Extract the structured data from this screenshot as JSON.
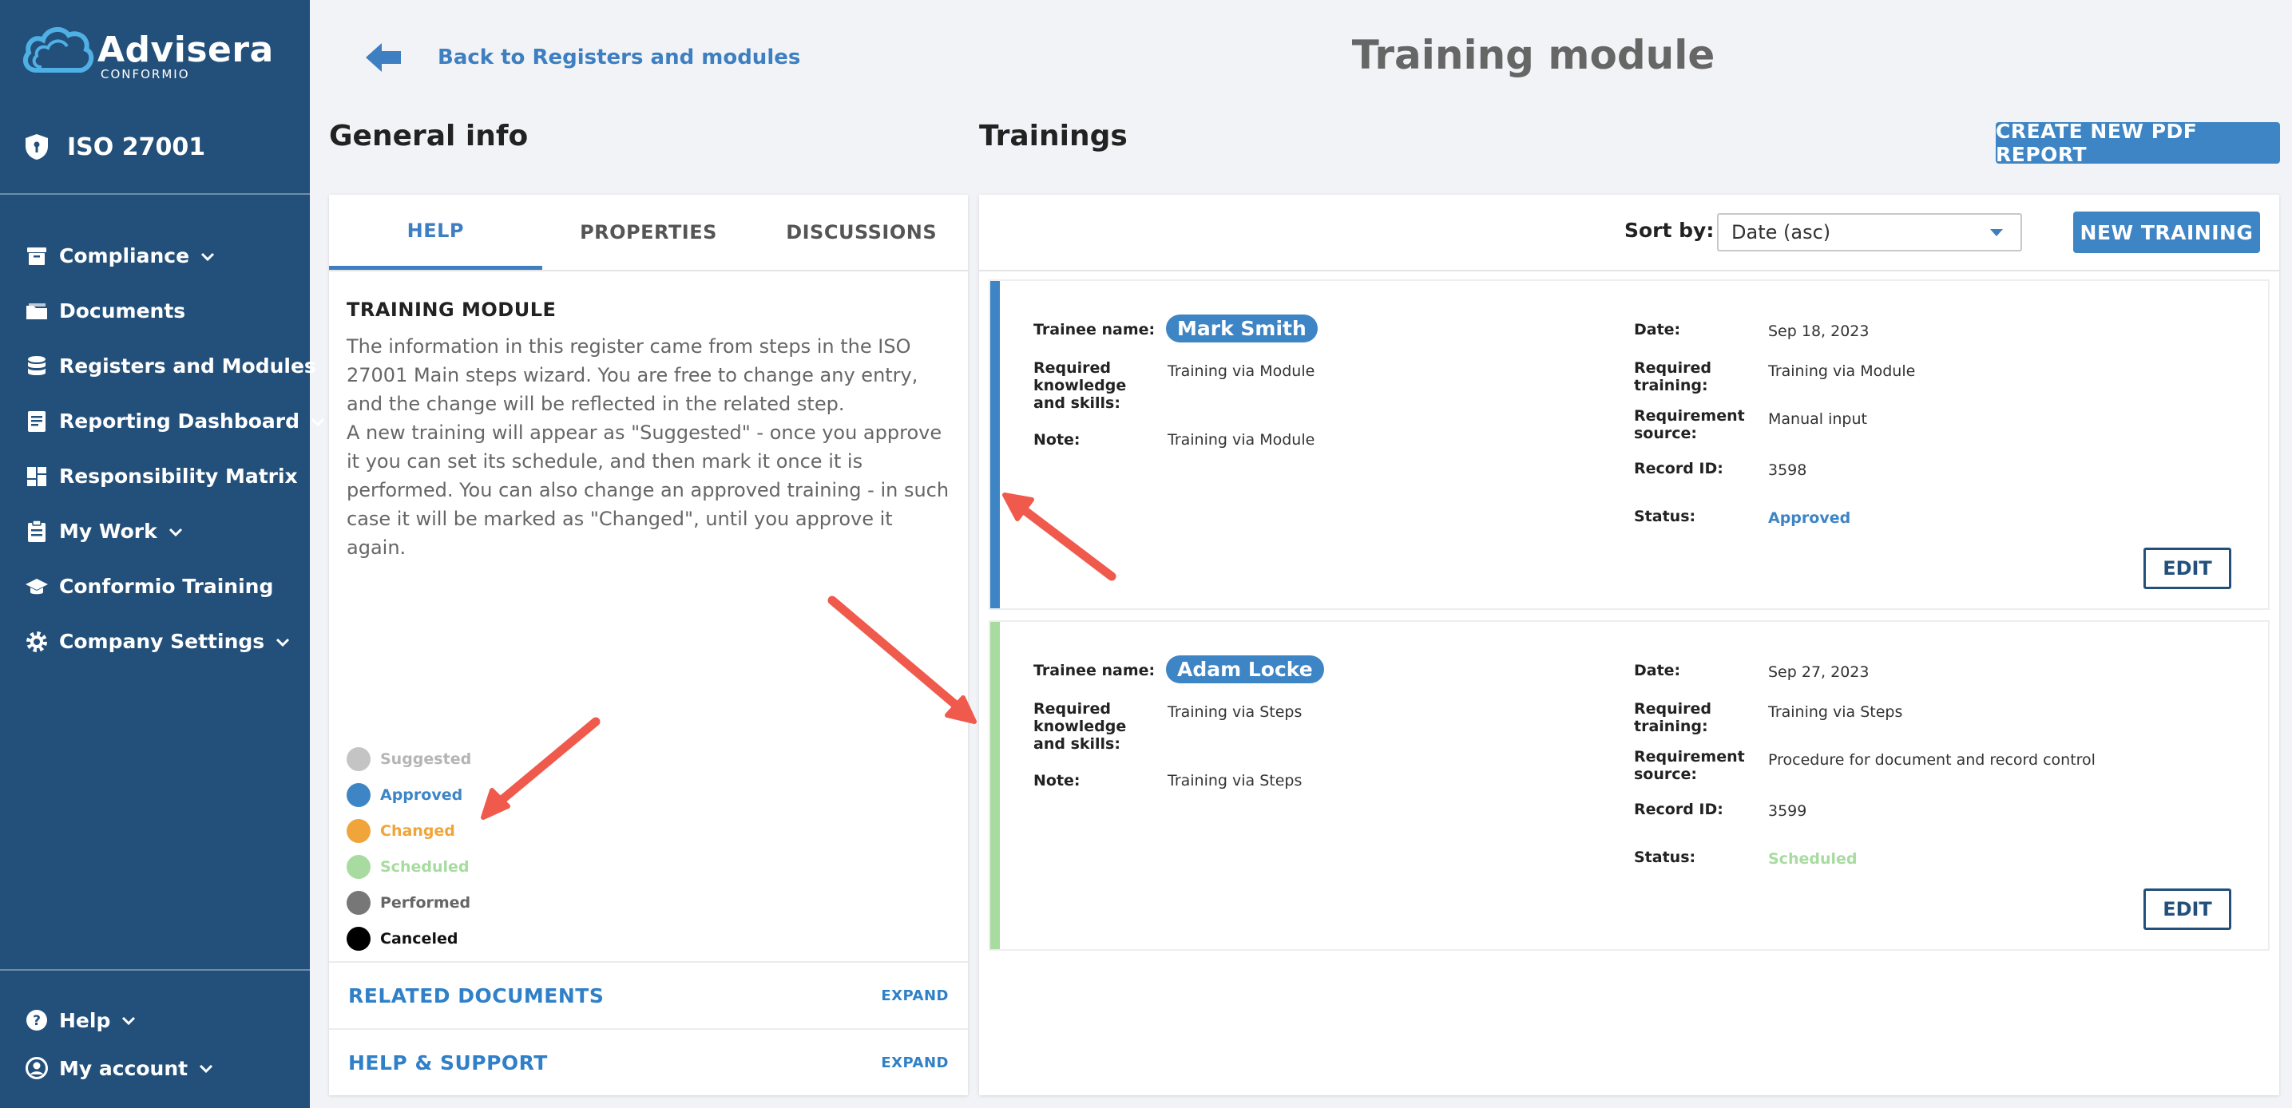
{
  "sidebar": {
    "logo_text": "Advisera",
    "logo_sub": "CONFORMIO",
    "standard": "ISO 27001",
    "items": [
      {
        "label": "Compliance",
        "icon": "archive-icon",
        "chevron": true
      },
      {
        "label": "Documents",
        "icon": "folder-icon",
        "chevron": false
      },
      {
        "label": "Registers and Modules",
        "icon": "database-icon",
        "chevron": false
      },
      {
        "label": "Reporting Dashboard",
        "icon": "report-icon",
        "chevron": true
      },
      {
        "label": "Responsibility Matrix",
        "icon": "dashboard-icon",
        "chevron": false
      },
      {
        "label": "My Work",
        "icon": "clipboard-icon",
        "chevron": true
      },
      {
        "label": "Conformio Training",
        "icon": "graduation-cap-icon",
        "chevron": false
      },
      {
        "label": "Company Settings",
        "icon": "gear-icon",
        "chevron": true
      }
    ],
    "bottom": [
      {
        "label": "Help",
        "icon": "help-circle-icon"
      },
      {
        "label": "My account",
        "icon": "account-icon"
      }
    ]
  },
  "header": {
    "back_label": "Back to Registers and modules",
    "title": "Training module"
  },
  "general": {
    "title": "General info",
    "tabs": [
      "HELP",
      "PROPERTIES",
      "DISCUSSIONS"
    ],
    "active_tab": "HELP",
    "help_title": "TRAINING MODULE",
    "help_text": "The information in this register came from steps in the ISO 27001 Main steps wizard. You are free to change any entry, and the change will be reflected in the related step.\nA new training will appear as \"Suggested\" - once you approve it you can set its schedule, and then mark it once it is performed. You can also change an approved training - in such case it will be marked as \"Changed\", until you approve it again.",
    "legend": [
      {
        "label": "Suggested",
        "color": "#c4c4c4",
        "text_color": "#b5b5b5"
      },
      {
        "label": "Approved",
        "color": "#3e85c6",
        "text_color": "#3e85c6"
      },
      {
        "label": "Changed",
        "color": "#f0a53a",
        "text_color": "#f0a53a"
      },
      {
        "label": "Scheduled",
        "color": "#a8dba0",
        "text_color": "#a8dba0"
      },
      {
        "label": "Performed",
        "color": "#777777",
        "text_color": "#666666"
      },
      {
        "label": "Canceled",
        "color": "#000000",
        "text_color": "#111111"
      }
    ],
    "accordions": [
      {
        "title": "RELATED DOCUMENTS",
        "action": "EXPAND"
      },
      {
        "title": "HELP & SUPPORT",
        "action": "EXPAND"
      }
    ]
  },
  "trainings": {
    "title": "Trainings",
    "create_pdf_label": "CREATE NEW PDF REPORT",
    "sort_label": "Sort by:",
    "sort_value": "Date (asc)",
    "new_training_label": "NEW TRAINING",
    "labels": {
      "trainee": "Trainee name:",
      "knowledge": "Required knowledge and skills:",
      "note": "Note:",
      "date": "Date:",
      "required_training": "Required training:",
      "requirement_source": "Requirement source:",
      "record_id": "Record ID:",
      "status": "Status:"
    },
    "edit_label": "EDIT",
    "items": [
      {
        "trainee": "Mark Smith",
        "knowledge": "Training via Module",
        "note": "Training via Module",
        "date": "Sep 18, 2023",
        "required_training": "Training via Module",
        "requirement_source": "Manual input",
        "record_id": "3598",
        "status": "Approved",
        "status_color": "#3e85c6",
        "bar_color": "#3e85c6"
      },
      {
        "trainee": "Adam Locke",
        "knowledge": "Training via Steps",
        "note": "Training via Steps",
        "date": "Sep 27, 2023",
        "required_training": "Training via Steps",
        "requirement_source": "Procedure for document and record control",
        "record_id": "3599",
        "status": "Scheduled",
        "status_color": "#a8dba0",
        "bar_color": "#a8dba0"
      }
    ]
  }
}
